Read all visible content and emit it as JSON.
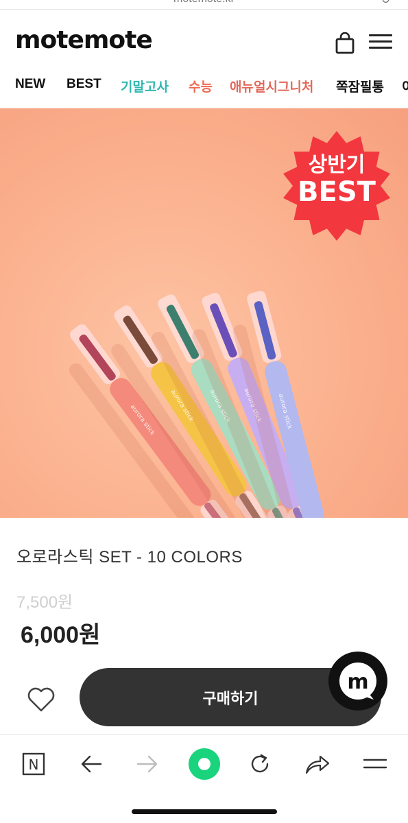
{
  "browser": {
    "url": "motemote.kr",
    "reload_glyph": "↻"
  },
  "header": {
    "logo": "motemote"
  },
  "categories": [
    {
      "label": "NEW",
      "color": "#111111"
    },
    {
      "label": "BEST",
      "color": "#111111"
    },
    {
      "label": "기말고사",
      "color": "#2fb8b0"
    },
    {
      "label": "수능",
      "color": "#ef6b55"
    },
    {
      "label": "애뉴얼시그니처",
      "color": "#e2685a"
    },
    {
      "label": "쪽잠필통",
      "color": "#111111"
    },
    {
      "label": "이",
      "color": "#111111"
    }
  ],
  "hero": {
    "badge_line1": "상반기",
    "badge_line2": "BEST",
    "badge_color": "#f2373f",
    "pen_print": "aurora stick",
    "pen_colors": [
      "#f48a7c",
      "#f5c446",
      "#a9dcc0",
      "#c7aef0",
      "#b3b8ee"
    ],
    "tip_colors": [
      "#b2455a",
      "#7a4a3a",
      "#3d7f6e",
      "#6a4fb8",
      "#5a62c4"
    ]
  },
  "product": {
    "name": "오로라스틱 SET - 10 COLORS",
    "price_original": "7,500원",
    "price_sale": "6,000원"
  },
  "actions": {
    "buy_label": "구매하기"
  },
  "chat": {
    "glyph": "m"
  },
  "toolbar": {
    "home_glyph": "N",
    "accent": "#19d47d"
  }
}
